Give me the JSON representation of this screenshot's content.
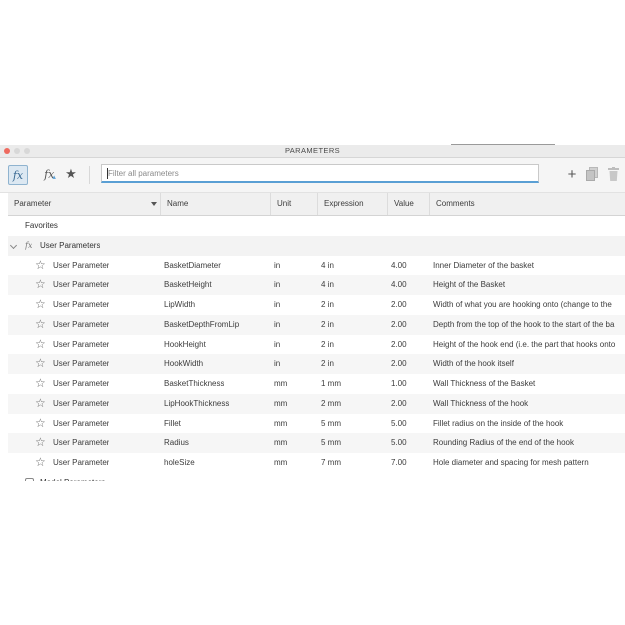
{
  "window": {
    "title": "PARAMETERS",
    "traffic_lights": {
      "close": "#ee6a5f",
      "minimize": "#d8d8d8",
      "maximize": "#d8d8d8"
    }
  },
  "toolbar": {
    "fx_icon": "fx",
    "fx_sort_icon": "fx",
    "favorites_icon": "★",
    "search": {
      "placeholder": "Filter all parameters",
      "value": ""
    },
    "add_icon": "+",
    "accent": "#5a9fd4"
  },
  "columns": [
    "Parameter",
    "Name",
    "Unit",
    "Expression",
    "Value",
    "Comments"
  ],
  "favorites_label": "Favorites",
  "user_group": {
    "icon": "fx",
    "label": "User Parameters"
  },
  "rows": [
    {
      "type": "User Parameter",
      "name": "BasketDiameter",
      "unit": "in",
      "expression": "4 in",
      "value": "4.00",
      "comment": "Inner Diameter of the basket"
    },
    {
      "type": "User Parameter",
      "name": "BasketHeight",
      "unit": "in",
      "expression": "4 in",
      "value": "4.00",
      "comment": "Height of the Basket"
    },
    {
      "type": "User Parameter",
      "name": "LipWidth",
      "unit": "in",
      "expression": "2 in",
      "value": "2.00",
      "comment": "Width of what you are hooking onto (change to the"
    },
    {
      "type": "User Parameter",
      "name": "BasketDepthFromLip",
      "unit": "in",
      "expression": "2 in",
      "value": "2.00",
      "comment": "Depth from the top of the hook to the start of the ba"
    },
    {
      "type": "User Parameter",
      "name": "HookHeight",
      "unit": "in",
      "expression": "2 in",
      "value": "2.00",
      "comment": "Height of the hook end (i.e. the part that hooks onto"
    },
    {
      "type": "User Parameter",
      "name": "HookWidth",
      "unit": "in",
      "expression": "2 in",
      "value": "2.00",
      "comment": "Width of the hook itself"
    },
    {
      "type": "User Parameter",
      "name": "BasketThickness",
      "unit": "mm",
      "expression": "1 mm",
      "value": "1.00",
      "comment": "Wall Thickness of the Basket"
    },
    {
      "type": "User Parameter",
      "name": "LipHookThickness",
      "unit": "mm",
      "expression": "2 mm",
      "value": "2.00",
      "comment": "Wall Thickness of the hook"
    },
    {
      "type": "User Parameter",
      "name": "Fillet",
      "unit": "mm",
      "expression": "5 mm",
      "value": "5.00",
      "comment": "Fillet radius on the inside of the hook"
    },
    {
      "type": "User Parameter",
      "name": "Radius",
      "unit": "mm",
      "expression": "5 mm",
      "value": "5.00",
      "comment": "Rounding Radius of the end of the hook"
    },
    {
      "type": "User Parameter",
      "name": "holeSize",
      "unit": "mm",
      "expression": "7 mm",
      "value": "7.00",
      "comment": "Hole diameter and spacing for mesh pattern"
    }
  ],
  "model_group": {
    "label": "Model Parameters"
  }
}
